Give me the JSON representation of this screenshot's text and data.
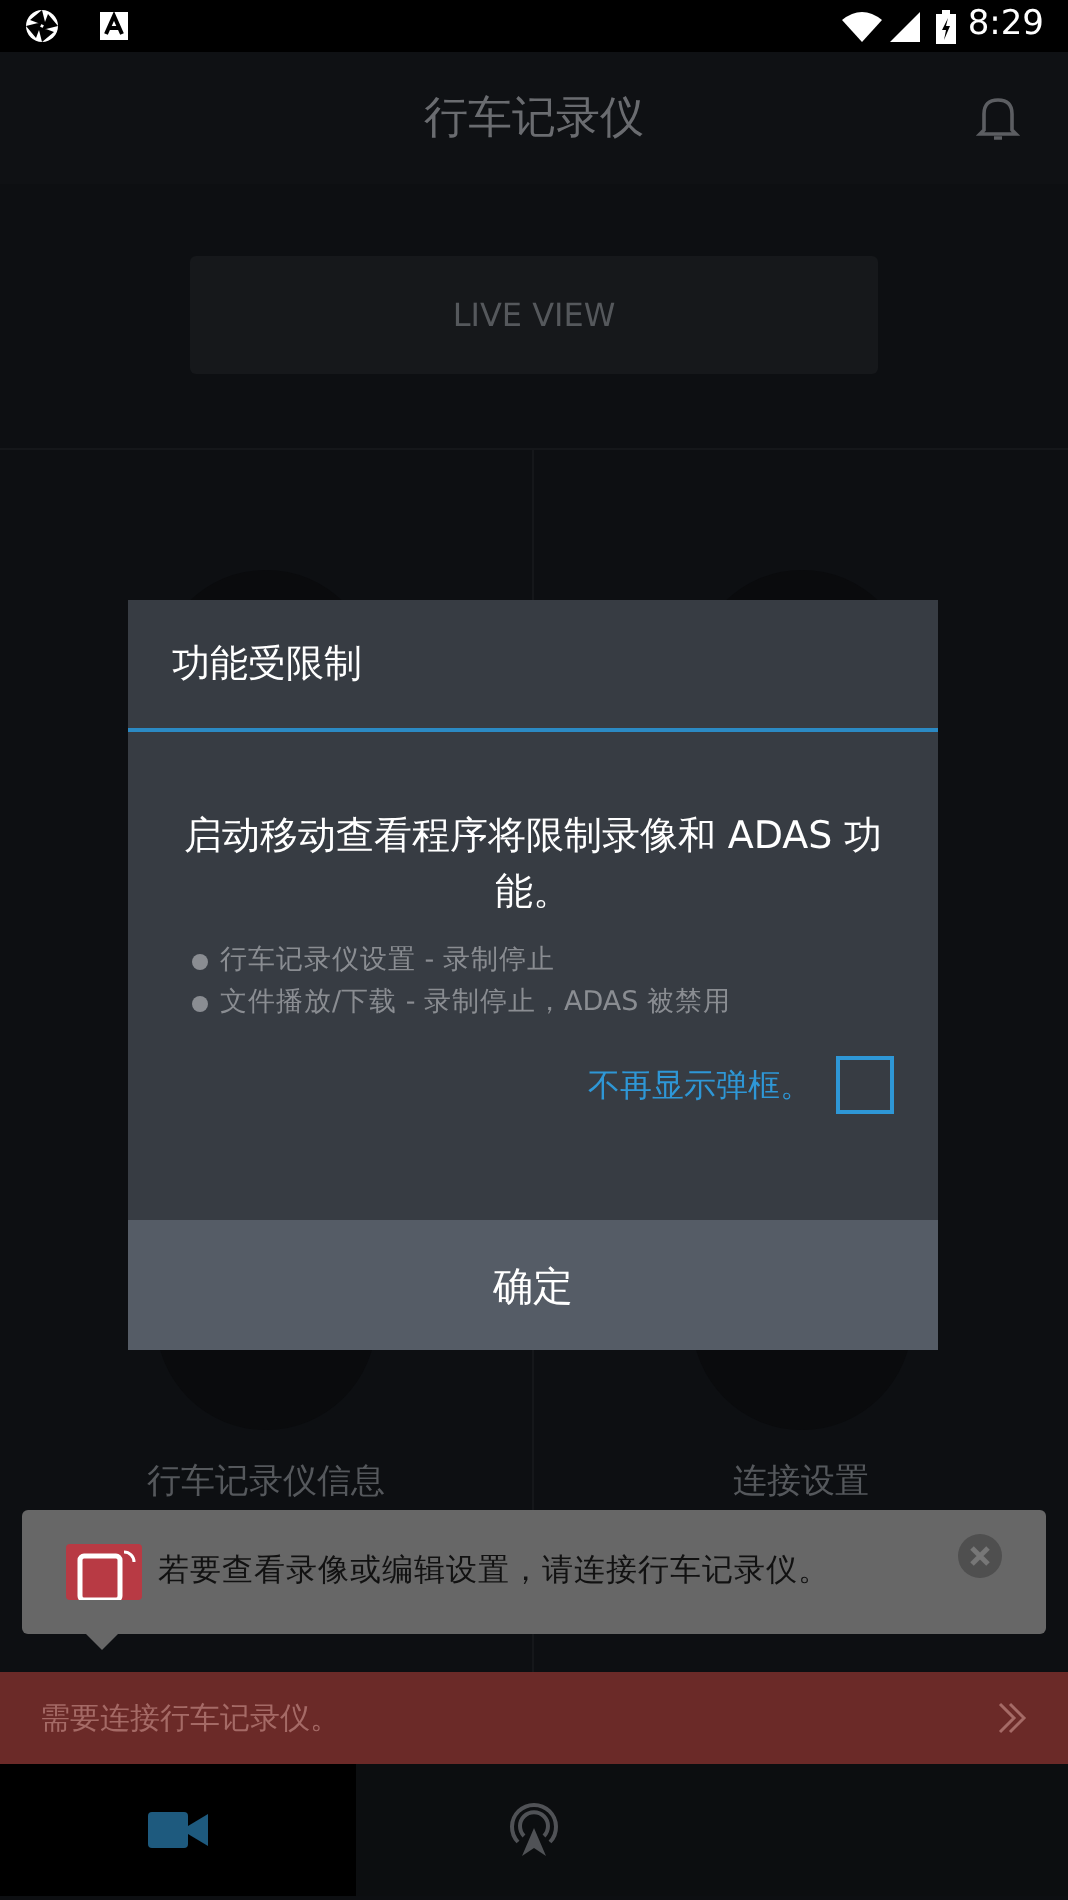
{
  "status_bar": {
    "time": "8:29"
  },
  "header": {
    "title": "行车记录仪"
  },
  "live_view_button": {
    "label": "LIVE VIEW"
  },
  "tiles": [
    {
      "label": "行车记录仪信息"
    },
    {
      "label": "连接设置"
    }
  ],
  "dialog": {
    "title": "功能受限制",
    "message": "启动移动查看程序将限制录像和 ADAS 功能。",
    "bullets": [
      "行车记录仪设置 - 录制停止",
      "文件播放/下载 - 录制停止，ADAS 被禁用"
    ],
    "dont_show": {
      "label": "不再显示弹框。",
      "checked": false
    },
    "ok_button": "确定"
  },
  "tooltip": {
    "text": "若要查看录像或编辑设置，请连接行车记录仪。"
  },
  "alert_bar": {
    "text": "需要连接行车记录仪。"
  },
  "bottom_nav": [
    {
      "kind": "camera",
      "selected": true
    },
    {
      "kind": "broadcast",
      "selected": false
    }
  ]
}
